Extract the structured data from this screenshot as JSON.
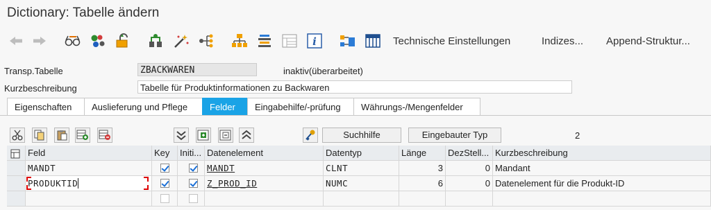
{
  "window": {
    "title": "Dictionary: Tabelle ändern"
  },
  "toolbar": {
    "icons": [
      "back-arrow-icon",
      "forward-arrow-icon",
      "glasses-icon",
      "other-object-icon",
      "activate-icon",
      "check-icon",
      "magic-wand-icon",
      "where-used-icon",
      "hierarchy-icon",
      "object-list-icon",
      "display-icon",
      "info-icon",
      "graphic-icon",
      "table-icon"
    ],
    "technical_settings": "Technische Einstellungen",
    "indexes": "Indizes...",
    "append_structure": "Append-Struktur..."
  },
  "header": {
    "table_label": "Transp.Tabelle",
    "table_name": "ZBACKWAREN",
    "status": "inaktiv(überarbeitet)",
    "desc_label": "Kurzbeschreibung",
    "description": "Tabelle für Produktinformationen zu Backwaren"
  },
  "tabs": [
    {
      "label": "Eigenschaften"
    },
    {
      "label": "Auslieferung und Pflege"
    },
    {
      "label": "Felder",
      "active": true
    },
    {
      "label": "Eingabehilfe/-prüfung"
    },
    {
      "label": "Währungs-/Mengenfelder"
    }
  ],
  "grid_toolbar": {
    "search_help": "Suchhilfe",
    "builtin_type": "Eingebauter Typ",
    "count": "2"
  },
  "table": {
    "columns": [
      "Feld",
      "Key",
      "Initi...",
      "Datenelement",
      "Datentyp",
      "Länge",
      "DezStell...",
      "Kurzbeschreibung"
    ],
    "rows": [
      {
        "field": "MANDT",
        "key": true,
        "init": true,
        "element": "MANDT",
        "type": "CLNT",
        "length": "3",
        "decimals": "0",
        "desc": "Mandant"
      },
      {
        "field": "PRODUKTID",
        "key": true,
        "init": true,
        "element": "Z_PROD_ID",
        "type": "NUMC",
        "length": "6",
        "decimals": "0",
        "desc": "Datenelement für die Produkt-ID"
      },
      {
        "field": "",
        "key": false,
        "init": false,
        "element": "",
        "type": "",
        "length": "",
        "decimals": "",
        "desc": ""
      }
    ]
  }
}
